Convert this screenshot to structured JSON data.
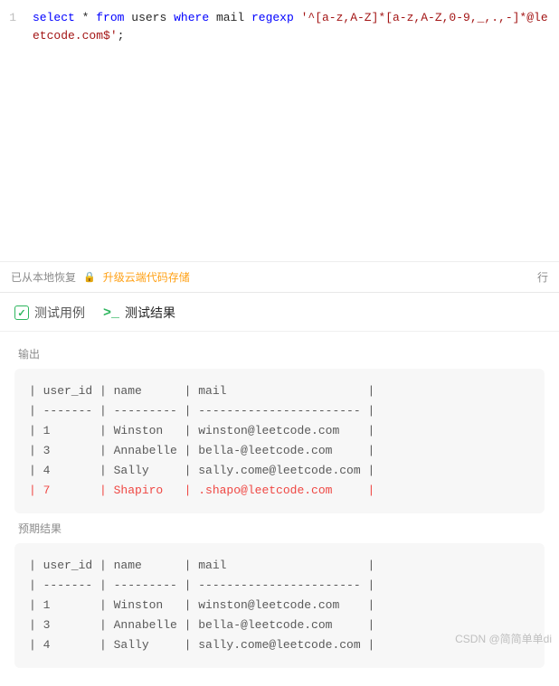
{
  "editor": {
    "line_number": "1",
    "tokens": [
      {
        "t": "kw",
        "v": "select"
      },
      {
        "t": "sp",
        "v": " "
      },
      {
        "t": "op",
        "v": "*"
      },
      {
        "t": "sp",
        "v": " "
      },
      {
        "t": "kw",
        "v": "from"
      },
      {
        "t": "sp",
        "v": " "
      },
      {
        "t": "ident",
        "v": "users"
      },
      {
        "t": "sp",
        "v": " "
      },
      {
        "t": "kw",
        "v": "where"
      },
      {
        "t": "sp",
        "v": " "
      },
      {
        "t": "ident",
        "v": "mail"
      },
      {
        "t": "sp",
        "v": " "
      },
      {
        "t": "kw",
        "v": "regexp"
      },
      {
        "t": "sp",
        "v": " "
      },
      {
        "t": "str",
        "v": "'^[a-z,A-Z]*[a-z,A-Z,0-9,_,.,-]*@leetcode.com$'"
      },
      {
        "t": "op",
        "v": ";"
      }
    ]
  },
  "status": {
    "restored": "已从本地恢复",
    "upgrade": "升级云端代码存储",
    "right_label": "行"
  },
  "tabs": {
    "testcase": "测试用例",
    "testresult": "测试结果"
  },
  "results": {
    "output_label": "输出",
    "expected_label": "预期结果",
    "columns": [
      "user_id",
      "name",
      "mail"
    ],
    "output_rows": [
      {
        "user_id": "1",
        "name": "Winston",
        "mail": "winston@leetcode.com",
        "diff": false
      },
      {
        "user_id": "3",
        "name": "Annabelle",
        "mail": "bella-@leetcode.com",
        "diff": false
      },
      {
        "user_id": "4",
        "name": "Sally",
        "mail": "sally.come@leetcode.com",
        "diff": false
      },
      {
        "user_id": "7",
        "name": "Shapiro",
        "mail": ".shapo@leetcode.com",
        "diff": true
      }
    ],
    "expected_rows": [
      {
        "user_id": "1",
        "name": "Winston",
        "mail": "winston@leetcode.com"
      },
      {
        "user_id": "3",
        "name": "Annabelle",
        "mail": "bella-@leetcode.com"
      },
      {
        "user_id": "4",
        "name": "Sally",
        "mail": "sally.come@leetcode.com"
      }
    ]
  },
  "watermark": "CSDN @简简单单di"
}
